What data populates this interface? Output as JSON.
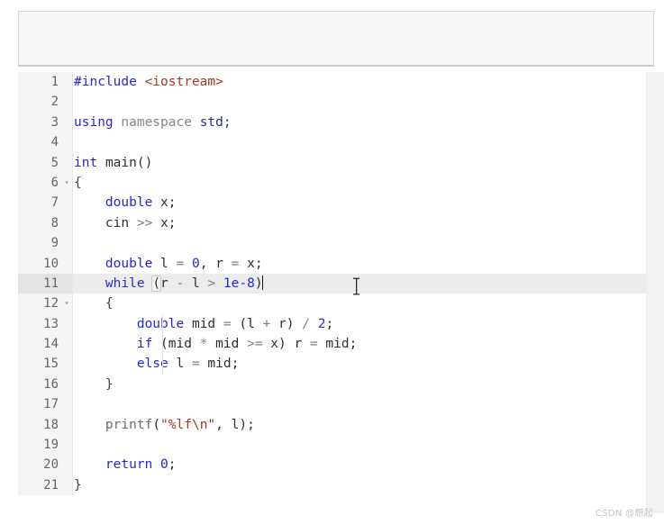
{
  "window": {
    "toolbar_placeholder": ""
  },
  "editor": {
    "language": "C++",
    "active_line": 11,
    "caret_after": ")",
    "fold_marker": "▾",
    "lines": [
      {
        "n": "1",
        "fold": "",
        "text": "#include <iostream>"
      },
      {
        "n": "2",
        "fold": "",
        "text": ""
      },
      {
        "n": "3",
        "fold": "",
        "text": "using namespace std;"
      },
      {
        "n": "4",
        "fold": "",
        "text": ""
      },
      {
        "n": "5",
        "fold": "",
        "text": "int main()"
      },
      {
        "n": "6",
        "fold": "▾",
        "text": "{"
      },
      {
        "n": "7",
        "fold": "",
        "text": "    double x;"
      },
      {
        "n": "8",
        "fold": "",
        "text": "    cin >> x;"
      },
      {
        "n": "9",
        "fold": "",
        "text": ""
      },
      {
        "n": "10",
        "fold": "",
        "text": "    double l = 0, r = x;"
      },
      {
        "n": "11",
        "fold": "",
        "text": "    while (r - l > 1e-8)"
      },
      {
        "n": "12",
        "fold": "▾",
        "text": "    {"
      },
      {
        "n": "13",
        "fold": "",
        "text": "        double mid = (l + r) / 2;"
      },
      {
        "n": "14",
        "fold": "",
        "text": "        if (mid * mid >= x) r = mid;"
      },
      {
        "n": "15",
        "fold": "",
        "text": "        else l = mid;"
      },
      {
        "n": "16",
        "fold": "",
        "text": "    }"
      },
      {
        "n": "17",
        "fold": "",
        "text": ""
      },
      {
        "n": "18",
        "fold": "",
        "text": "    printf(\"%lf\\n\", l);"
      },
      {
        "n": "19",
        "fold": "",
        "text": ""
      },
      {
        "n": "20",
        "fold": "",
        "text": "    return 0;"
      },
      {
        "n": "21",
        "fold": "",
        "text": "}"
      }
    ],
    "tokens": {
      "l1": [
        [
          "#include",
          "kw"
        ],
        [
          " ",
          "plain"
        ],
        [
          "<iostream>",
          "inc"
        ]
      ],
      "l3": [
        [
          "using",
          "kw"
        ],
        [
          " ",
          "plain"
        ],
        [
          "namespace",
          "gray"
        ],
        [
          " ",
          "plain"
        ],
        [
          "std",
          "navy"
        ],
        [
          ";",
          "navy"
        ]
      ],
      "l5": [
        [
          "int",
          "kw"
        ],
        [
          " ",
          "plain"
        ],
        [
          "main()",
          "ident"
        ]
      ],
      "l6": [
        [
          "{",
          "punc"
        ]
      ],
      "l7": [
        [
          "    ",
          "plain"
        ],
        [
          "double",
          "kw"
        ],
        [
          " ",
          "plain"
        ],
        [
          "x",
          "ident"
        ],
        [
          ";",
          "ident"
        ]
      ],
      "l8": [
        [
          "    ",
          "plain"
        ],
        [
          "cin",
          "ident"
        ],
        [
          " ",
          "plain"
        ],
        [
          ">>",
          "op"
        ],
        [
          " ",
          "plain"
        ],
        [
          "x",
          "ident"
        ],
        [
          ";",
          "ident"
        ]
      ],
      "l10": [
        [
          "    ",
          "plain"
        ],
        [
          "double",
          "kw"
        ],
        [
          " ",
          "plain"
        ],
        [
          "l",
          "ident"
        ],
        [
          " ",
          "plain"
        ],
        [
          "=",
          "op"
        ],
        [
          " ",
          "plain"
        ],
        [
          "0",
          "num"
        ],
        [
          ", ",
          "ident"
        ],
        [
          "r",
          "ident"
        ],
        [
          " ",
          "plain"
        ],
        [
          "=",
          "op"
        ],
        [
          " ",
          "plain"
        ],
        [
          "x",
          "ident"
        ],
        [
          ";",
          "ident"
        ]
      ],
      "l11": [
        [
          "    ",
          "plain"
        ],
        [
          "while",
          "kw"
        ],
        [
          " ",
          "plain"
        ],
        [
          "(",
          "brmatch"
        ],
        [
          "r",
          "ident"
        ],
        [
          " ",
          "plain"
        ],
        [
          "-",
          "op"
        ],
        [
          " ",
          "plain"
        ],
        [
          "l",
          "ident"
        ],
        [
          " ",
          "plain"
        ],
        [
          ">",
          "op"
        ],
        [
          " ",
          "plain"
        ],
        [
          "1e-8",
          "num"
        ],
        [
          ")",
          "ident"
        ]
      ],
      "l12": [
        [
          "    ",
          "plain"
        ],
        [
          "{",
          "punc"
        ]
      ],
      "l13": [
        [
          "        ",
          "plain"
        ],
        [
          "double",
          "kw"
        ],
        [
          " ",
          "plain"
        ],
        [
          "mid",
          "ident"
        ],
        [
          " ",
          "plain"
        ],
        [
          "=",
          "op"
        ],
        [
          " ",
          "plain"
        ],
        [
          "(l ",
          "ident"
        ],
        [
          "+",
          "op"
        ],
        [
          " r)",
          "ident"
        ],
        [
          " ",
          "plain"
        ],
        [
          "/",
          "op"
        ],
        [
          " ",
          "plain"
        ],
        [
          "2",
          "num"
        ],
        [
          ";",
          "ident"
        ]
      ],
      "l14": [
        [
          "        ",
          "plain"
        ],
        [
          "if",
          "kw"
        ],
        [
          " ",
          "plain"
        ],
        [
          "(mid ",
          "ident"
        ],
        [
          "*",
          "op"
        ],
        [
          " mid ",
          "ident"
        ],
        [
          ">=",
          "op"
        ],
        [
          " x) r ",
          "ident"
        ],
        [
          "=",
          "op"
        ],
        [
          " mid;",
          "ident"
        ]
      ],
      "l15": [
        [
          "        ",
          "plain"
        ],
        [
          "else",
          "kw"
        ],
        [
          " ",
          "plain"
        ],
        [
          "l ",
          "ident"
        ],
        [
          "=",
          "op"
        ],
        [
          " mid;",
          "ident"
        ]
      ],
      "l16": [
        [
          "    ",
          "plain"
        ],
        [
          "}",
          "punc"
        ]
      ],
      "l18": [
        [
          "    ",
          "plain"
        ],
        [
          "printf",
          "fn"
        ],
        [
          "(",
          "ident"
        ],
        [
          "\"%lf\\n\"",
          "str"
        ],
        [
          ", ",
          "ident"
        ],
        [
          "l",
          "ident"
        ],
        [
          ");",
          "ident"
        ]
      ],
      "l20": [
        [
          "    ",
          "plain"
        ],
        [
          "return",
          "kw"
        ],
        [
          " ",
          "plain"
        ],
        [
          "0",
          "num"
        ],
        [
          ";",
          "ident"
        ]
      ],
      "l21": [
        [
          "}",
          "punc"
        ]
      ]
    }
  },
  "watermark": {
    "text": "CSDN @想起"
  }
}
